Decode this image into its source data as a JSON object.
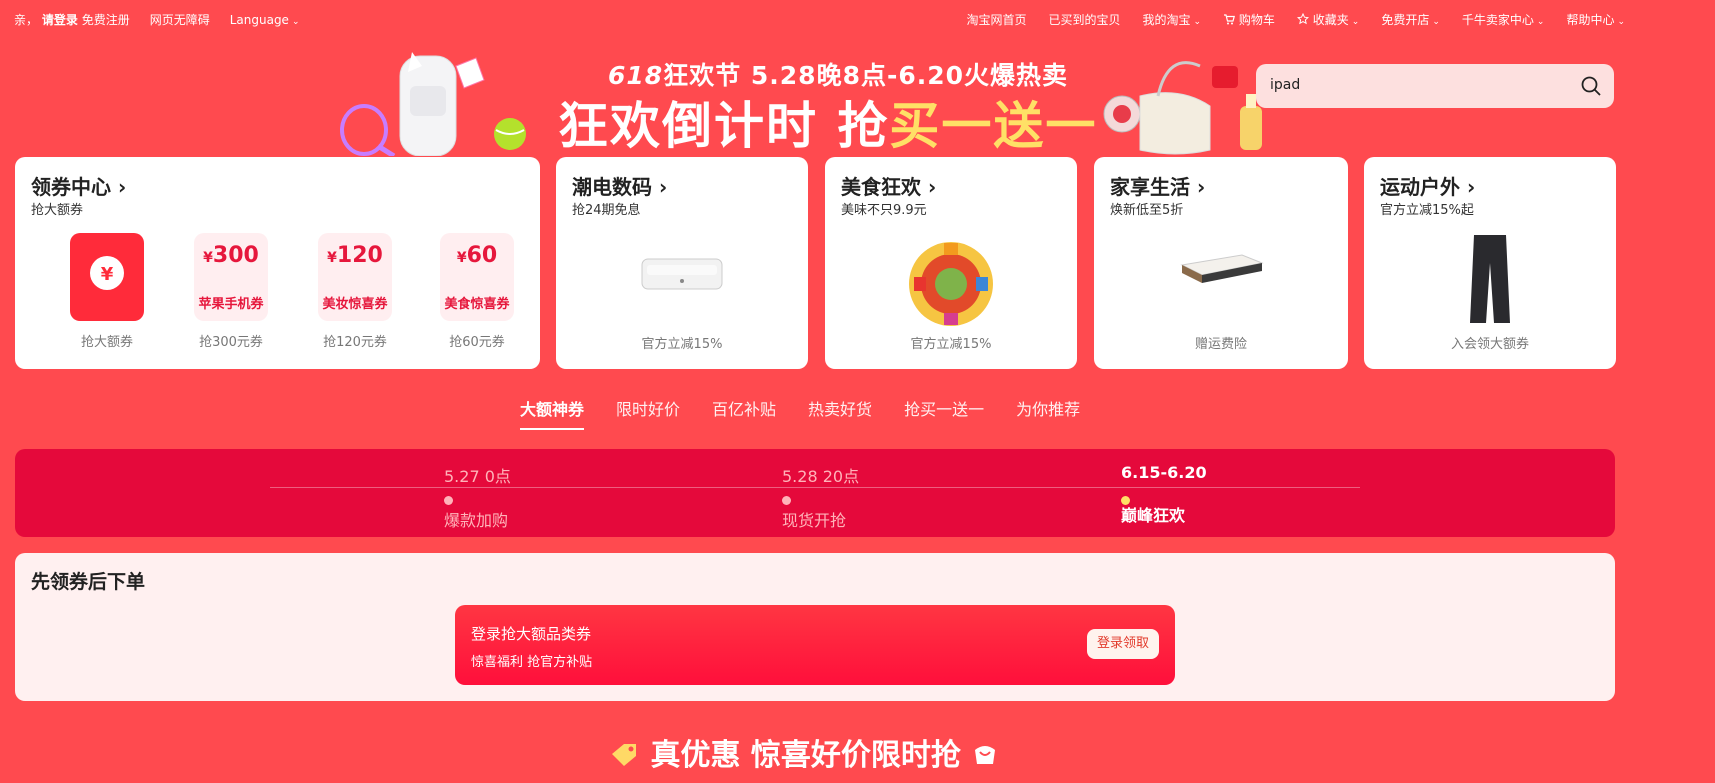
{
  "topbar": {
    "greeting": "亲，",
    "login": "请登录",
    "register": "免费注册",
    "accessibility": "网页无障碍",
    "language": "Language",
    "right_links": [
      "淘宝网首页",
      "已买到的宝贝",
      "我的淘宝",
      "购物车",
      "收藏夹",
      "免费开店",
      "千牛卖家中心",
      "帮助中心"
    ]
  },
  "banner": {
    "line1_prefix": "618",
    "line1_rest": "狂欢节 5.28晚8点-6.20火爆热卖",
    "line2_white": "狂欢倒计时 抢",
    "line2_highlight": "买一送一"
  },
  "search": {
    "value": "ipad"
  },
  "coupon_card": {
    "title": "领券中心",
    "subtitle": "抢大额券",
    "items": [
      {
        "amount": "",
        "label": "",
        "caption": "抢大额券"
      },
      {
        "amount": "300",
        "label": "苹果手机券",
        "caption": "抢300元券"
      },
      {
        "amount": "120",
        "label": "美妆惊喜券",
        "caption": "抢120元券"
      },
      {
        "amount": "60",
        "label": "美食惊喜券",
        "caption": "抢60元券"
      }
    ],
    "currency": "¥"
  },
  "category_cards": [
    {
      "title": "潮电数码",
      "subtitle": "抢24期免息",
      "caption": "官方立减15%"
    },
    {
      "title": "美食狂欢",
      "subtitle": "美味不只9.9元",
      "caption": "官方立减15%"
    },
    {
      "title": "家享生活",
      "subtitle": "焕新低至5折",
      "caption": "赠运费险"
    },
    {
      "title": "运动户外",
      "subtitle": "官方立减15%起",
      "caption": "入会领大额券"
    }
  ],
  "tabs": [
    "大额神券",
    "限时好价",
    "百亿补贴",
    "热卖好货",
    "抢买一送一",
    "为你推荐"
  ],
  "timeline": [
    {
      "date": "5.27 0点",
      "name": "爆款加购"
    },
    {
      "date": "5.28 20点",
      "name": "现货开抢"
    },
    {
      "date": "6.15-6.20",
      "name": "巅峰狂欢"
    }
  ],
  "panel": {
    "title": "先领券后下单",
    "promo_title": "登录抢大额品类券",
    "promo_sub": "惊喜福利 抢官方补贴",
    "promo_button": "登录领取"
  },
  "footer_title": "真优惠 惊喜好价限时抢",
  "colors": {
    "background": "#ff4a4f",
    "accent_red": "#e5093b",
    "highlight_yellow": "#ffe066"
  }
}
